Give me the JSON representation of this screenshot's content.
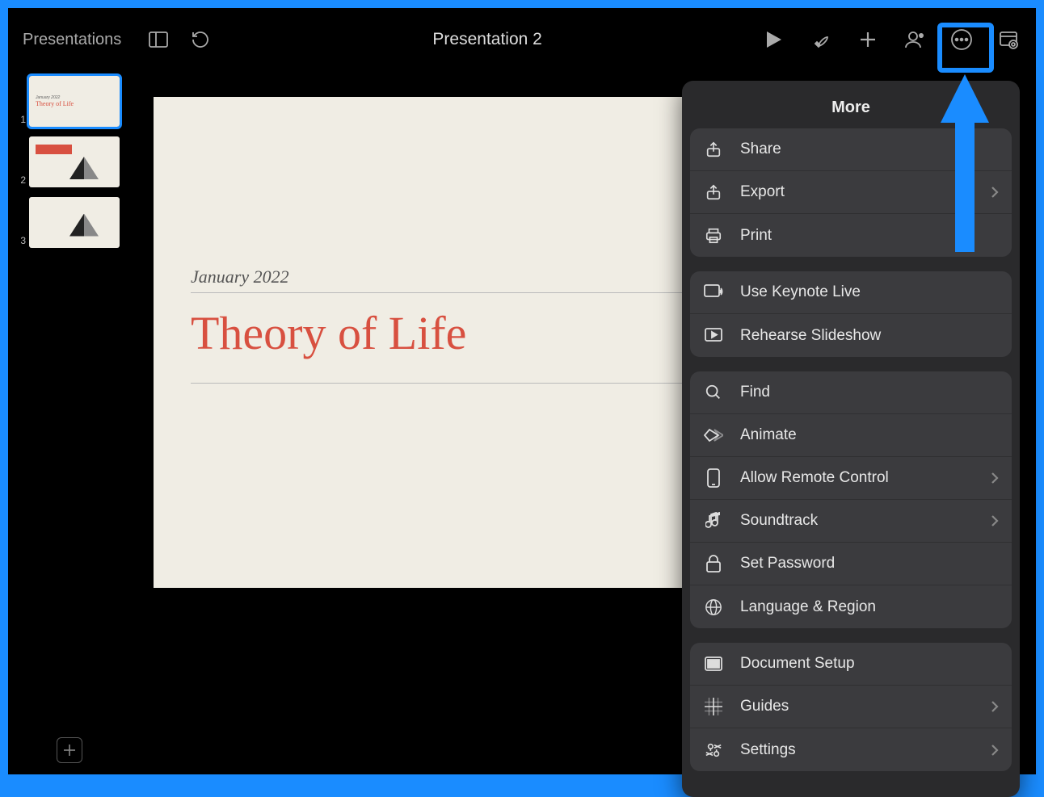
{
  "toolbar": {
    "back_label": "Presentations",
    "title": "Presentation 2"
  },
  "slidebar": {
    "thumbs": [
      {
        "num": "1",
        "subtitle": "January 2022",
        "title": "Theory of Life"
      },
      {
        "num": "2"
      },
      {
        "num": "3"
      }
    ]
  },
  "slide": {
    "subtitle": "January 2022",
    "title": "Theory of Life"
  },
  "more": {
    "title": "More",
    "sections": [
      {
        "items": [
          {
            "icon": "share-icon",
            "label": "Share",
            "chevron": false
          },
          {
            "icon": "export-icon",
            "label": "Export",
            "chevron": true
          },
          {
            "icon": "print-icon",
            "label": "Print",
            "chevron": false
          }
        ]
      },
      {
        "items": [
          {
            "icon": "live-icon",
            "label": "Use Keynote Live",
            "chevron": false
          },
          {
            "icon": "rehearse-icon",
            "label": "Rehearse Slideshow",
            "chevron": false
          }
        ]
      },
      {
        "items": [
          {
            "icon": "find-icon",
            "label": "Find",
            "chevron": false
          },
          {
            "icon": "animate-icon",
            "label": "Animate",
            "chevron": false
          },
          {
            "icon": "remote-icon",
            "label": "Allow Remote Control",
            "chevron": true
          },
          {
            "icon": "soundtrack-icon",
            "label": "Soundtrack",
            "chevron": true
          },
          {
            "icon": "password-icon",
            "label": "Set Password",
            "chevron": false
          },
          {
            "icon": "language-icon",
            "label": "Language & Region",
            "chevron": false
          }
        ]
      },
      {
        "items": [
          {
            "icon": "docsetup-icon",
            "label": "Document Setup",
            "chevron": false
          },
          {
            "icon": "guides-icon",
            "label": "Guides",
            "chevron": true
          },
          {
            "icon": "settings-icon",
            "label": "Settings",
            "chevron": true
          }
        ]
      }
    ]
  }
}
